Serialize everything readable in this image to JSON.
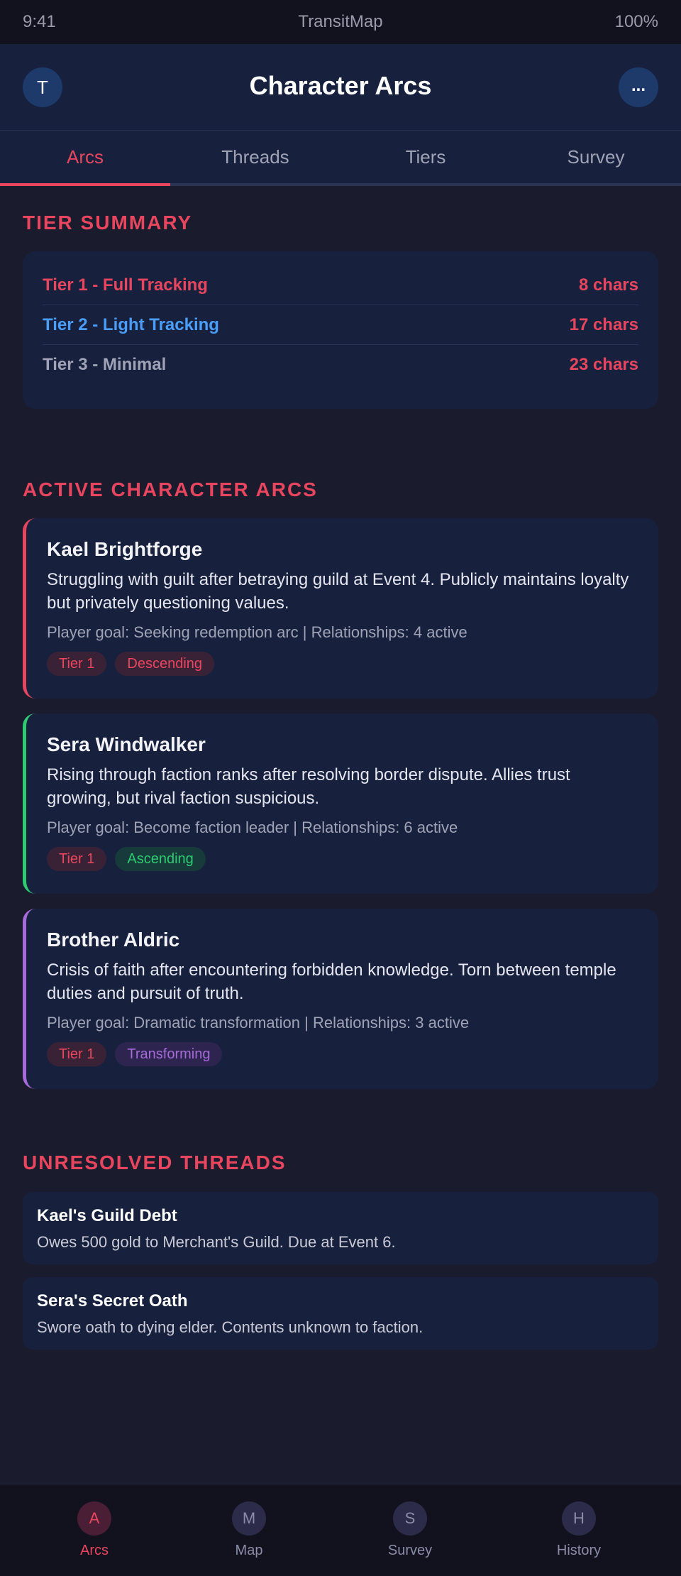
{
  "status_bar": {
    "time": "9:41",
    "app_name": "TransitMap",
    "battery": "100%"
  },
  "header": {
    "avatar_initial": "T",
    "title": "Character Arcs",
    "more_label": "..."
  },
  "tabs": [
    {
      "label": "Arcs",
      "active": true
    },
    {
      "label": "Threads",
      "active": false
    },
    {
      "label": "Tiers",
      "active": false
    },
    {
      "label": "Survey",
      "active": false
    }
  ],
  "tier_summary": {
    "heading": "TIER SUMMARY",
    "rows": [
      {
        "label": "Tier 1 - Full Tracking",
        "count": "8 chars",
        "color": "#e8465e"
      },
      {
        "label": "Tier 2 - Light Tracking",
        "count": "17 chars",
        "color": "#4a9df8"
      },
      {
        "label": "Tier 3 - Minimal",
        "count": "23 chars",
        "color": "#a0a3b5"
      }
    ]
  },
  "active_arcs": {
    "heading": "ACTIVE CHARACTER ARCS",
    "arcs": [
      {
        "name": "Kael Brightforge",
        "description": "Struggling with guilt after betraying guild at Event 4. Publicly maintains loyalty but privately questioning values.",
        "meta": "Player goal: Seeking redemption arc | Relationships: 4 active",
        "tier_badge": "Tier 1",
        "trend_badge": "Descending",
        "accent_color": "#e8465e"
      },
      {
        "name": "Sera Windwalker",
        "description": "Rising through faction ranks after resolving border dispute. Allies trust growing, but rival faction suspicious.",
        "meta": "Player goal: Become faction leader | Relationships: 6 active",
        "tier_badge": "Tier 1",
        "trend_badge": "Ascending",
        "accent_color": "#2ecc71"
      },
      {
        "name": "Brother Aldric",
        "description": "Crisis of faith after encountering forbidden knowledge. Torn between temple duties and pursuit of truth.",
        "meta": "Player goal: Dramatic transformation | Relationships: 3 active",
        "tier_badge": "Tier 1",
        "trend_badge": "Transforming",
        "accent_color": "#a66bd8"
      }
    ]
  },
  "unresolved_threads": {
    "heading": "UNRESOLVED THREADS",
    "threads": [
      {
        "title": "Kael's Guild Debt",
        "description": "Owes 500 gold to Merchant's Guild. Due at Event 6."
      },
      {
        "title": "Sera's Secret Oath",
        "description": "Swore oath to dying elder. Contents unknown to faction."
      }
    ]
  },
  "bottom_nav": [
    {
      "icon_letter": "A",
      "label": "Arcs",
      "icon": "arcs-icon",
      "active": true
    },
    {
      "icon_letter": "M",
      "label": "Map",
      "icon": "map-icon",
      "active": false
    },
    {
      "icon_letter": "S",
      "label": "Survey",
      "icon": "survey-icon",
      "active": false
    },
    {
      "icon_letter": "H",
      "label": "History",
      "icon": "history-icon",
      "active": false
    }
  ]
}
